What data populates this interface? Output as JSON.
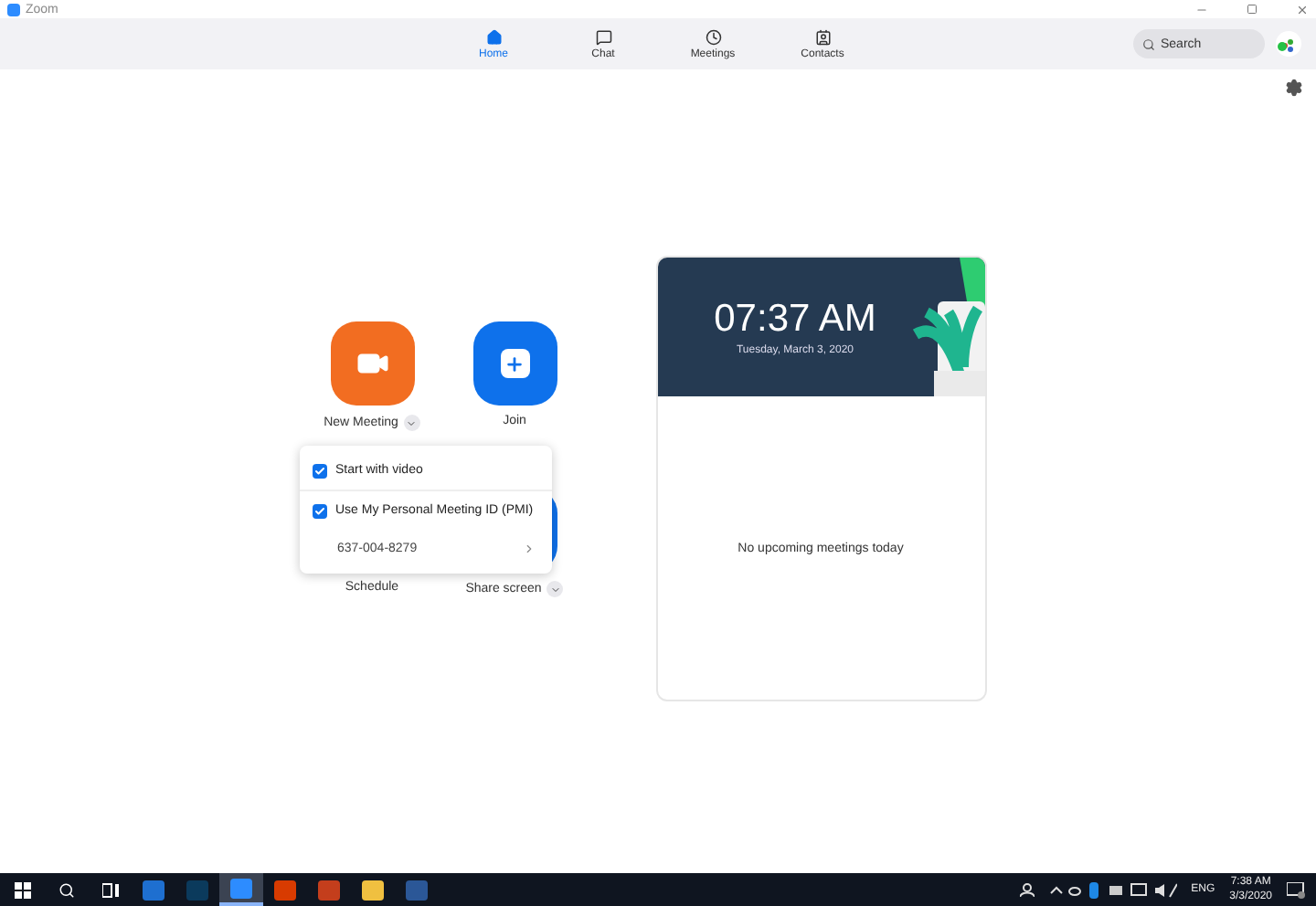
{
  "title_bar": {
    "app_name": "Zoom"
  },
  "nav_tabs": [
    {
      "label": "Home",
      "selected": true
    },
    {
      "label": "Chat",
      "selected": false
    },
    {
      "label": "Meetings",
      "selected": false
    },
    {
      "label": "Contacts",
      "selected": false
    }
  ],
  "search": {
    "placeholder": "Search"
  },
  "actions": [
    {
      "label": "New Meeting",
      "kind": "new_meeting",
      "has_menu": true
    },
    {
      "label": "Join",
      "kind": "join",
      "has_menu": false
    },
    {
      "label": "Schedule",
      "kind": "schedule",
      "has_menu": false
    },
    {
      "label": "Share screen",
      "kind": "share",
      "has_menu": true
    }
  ],
  "new_meeting_menu": {
    "options": [
      {
        "label": "Start with video",
        "checked": true
      },
      {
        "label": "Use My Personal Meeting ID (PMI)",
        "checked": true
      }
    ],
    "meeting_id": "637-004-8279"
  },
  "card": {
    "time": "07:37 AM",
    "date": "Tuesday, March 3, 2020",
    "empty_message": "No upcoming meetings today"
  },
  "taskbar": {
    "apps": [
      {
        "kind": "edge",
        "selected": false
      },
      {
        "kind": "photoshop",
        "selected": false
      },
      {
        "kind": "zoom",
        "selected": true
      },
      {
        "kind": "office",
        "selected": false
      },
      {
        "kind": "powerpoint",
        "selected": false
      },
      {
        "kind": "explorer",
        "selected": false
      },
      {
        "kind": "word",
        "selected": false
      }
    ],
    "language": "ENG",
    "time": "7:38 AM",
    "date": "3/3/2020"
  }
}
